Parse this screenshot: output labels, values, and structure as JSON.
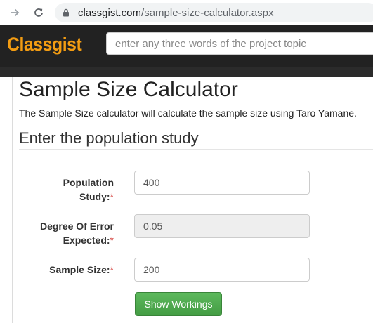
{
  "browser": {
    "url_host": "classgist.com",
    "url_path": "/sample-size-calculator.aspx"
  },
  "header": {
    "logo": "Classgist",
    "search_placeholder": "enter any three words of the project topic"
  },
  "main": {
    "title": "Sample Size Calculator",
    "description": "The Sample Size calculator will calculate the sample size using Taro Yamane.",
    "section_title": "Enter the population study"
  },
  "form": {
    "population_label_1": "Population",
    "population_label_2": "Study:",
    "population_value": "400",
    "error_label_1": "Degree Of Error",
    "error_label_2": "Expected:",
    "error_value": "0.05",
    "sample_label": "Sample Size:",
    "sample_value": "200",
    "required_marker": "*",
    "show_workings": "Show Workings"
  },
  "colors": {
    "logo": "#f39c12",
    "header_bg": "#222222",
    "button_green": "#5cb85c",
    "required": "#d9534f"
  }
}
